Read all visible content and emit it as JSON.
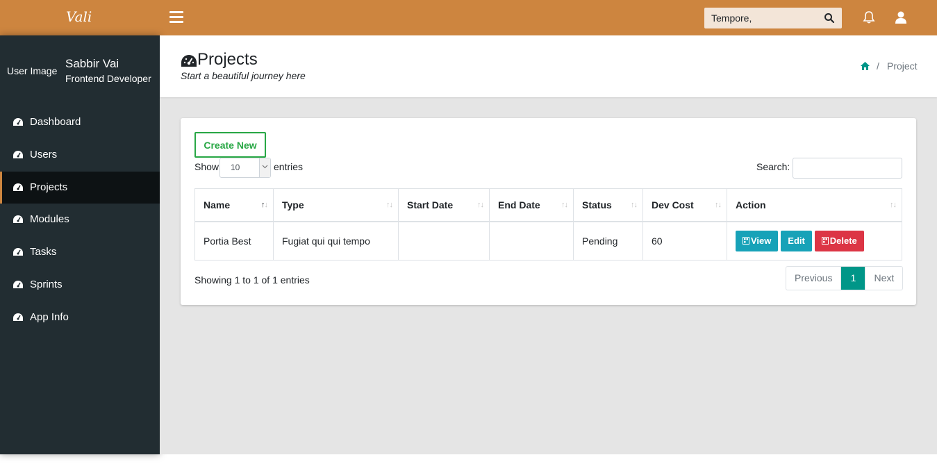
{
  "app": {
    "logo": "Vali"
  },
  "topbar": {
    "search_value": "Tempore,"
  },
  "sidebar": {
    "user_image_alt": "User Image",
    "user_name": "Sabbir Vai",
    "user_role": "Frontend Developer",
    "items": [
      {
        "label": "Dashboard",
        "active": false
      },
      {
        "label": "Users",
        "active": false
      },
      {
        "label": "Projects",
        "active": true
      },
      {
        "label": "Modules",
        "active": false
      },
      {
        "label": "Tasks",
        "active": false
      },
      {
        "label": "Sprints",
        "active": false
      },
      {
        "label": "App Info",
        "active": false
      }
    ]
  },
  "page": {
    "title": "Projects",
    "subtitle": "Start a beautiful journey here",
    "breadcrumb_current": "Project",
    "breadcrumb_separator": "/"
  },
  "tile": {
    "create_label": "Create New",
    "show_label": "Show",
    "entries_label": "entries",
    "page_length": "10",
    "search_label": "Search:",
    "search_value": ""
  },
  "table": {
    "columns": [
      "Name",
      "Type",
      "Start Date",
      "End Date",
      "Status",
      "Dev Cost",
      "Action"
    ],
    "rows": [
      {
        "name": "Portia Best",
        "type": "Fugiat qui qui tempo",
        "start_date": "",
        "end_date": "",
        "status": "Pending",
        "dev_cost": "60"
      }
    ],
    "actions": {
      "view": "View",
      "edit": "Edit",
      "delete": "Delete"
    }
  },
  "footer": {
    "info": "Showing 1 to 1 of 1 entries",
    "previous": "Previous",
    "current_page": "1",
    "next": "Next"
  },
  "colors": {
    "topbar": "#cd853f",
    "sidebar": "#222d32",
    "primary": "#009688",
    "success": "#28a745",
    "info": "#17a2b8",
    "danger": "#dc3545"
  }
}
